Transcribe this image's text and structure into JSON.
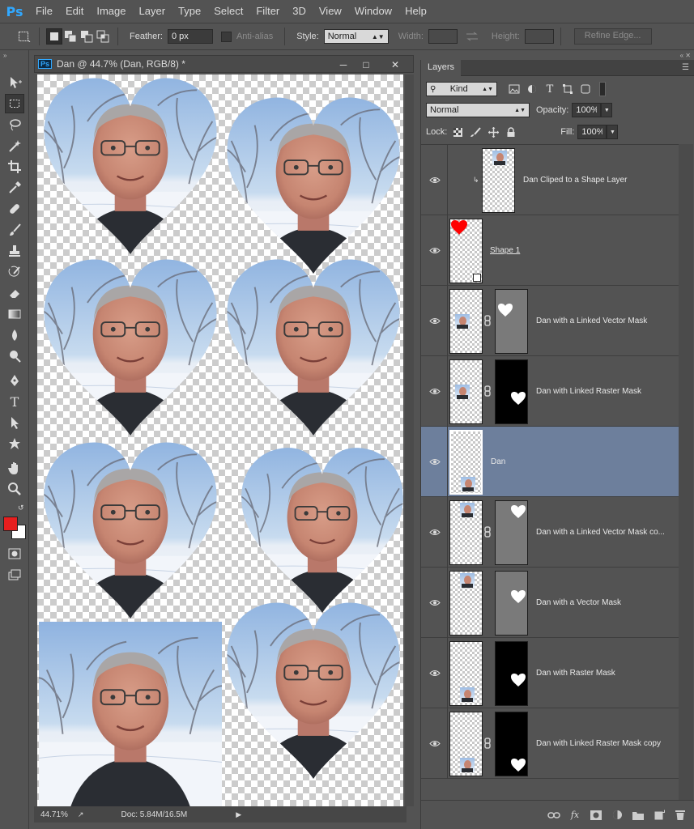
{
  "app": {
    "logo": "Ps"
  },
  "menu": [
    "File",
    "Edit",
    "Image",
    "Layer",
    "Type",
    "Select",
    "Filter",
    "3D",
    "View",
    "Window",
    "Help"
  ],
  "options": {
    "feather_label": "Feather:",
    "feather_value": "0 px",
    "antialias_label": "Anti-alias",
    "style_label": "Style:",
    "style_value": "Normal",
    "width_label": "Width:",
    "height_label": "Height:",
    "refine_edge_label": "Refine Edge..."
  },
  "document": {
    "title": "Dan @ 44.7% (Dan, RGB/8) *",
    "zoom": "44.71%",
    "doc_size": "Doc: 5.84M/16.5M"
  },
  "layers_panel": {
    "tab": "Layers",
    "filter_kind": "Kind",
    "blend_mode": "Normal",
    "opacity_label": "Opacity:",
    "opacity_value": "100%",
    "lock_label": "Lock:",
    "fill_label": "Fill:",
    "fill_value": "100%",
    "layers": [
      {
        "name": "Dan Cliped to a Shape Layer",
        "type": "clipped"
      },
      {
        "name": "Shape 1",
        "type": "shape"
      },
      {
        "name": "Dan with a Linked Vector Mask",
        "type": "vector-linked"
      },
      {
        "name": "Dan with Linked Raster Mask",
        "type": "raster-linked"
      },
      {
        "name": "Dan",
        "type": "plain",
        "selected": true
      },
      {
        "name": "Dan with a Linked Vector Mask co...",
        "type": "vector-linked"
      },
      {
        "name": "Dan with a Vector Mask",
        "type": "vector"
      },
      {
        "name": "Dan with Raster Mask",
        "type": "raster"
      },
      {
        "name": "Dan with Linked Raster Mask copy",
        "type": "raster-linked"
      }
    ]
  },
  "colors": {
    "foreground": "#e61e1e",
    "background": "#ffffff",
    "selection": "#6d7f9c",
    "shape_fill": "#ff0000"
  }
}
